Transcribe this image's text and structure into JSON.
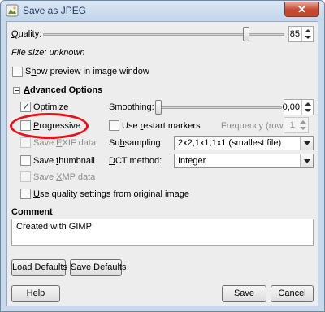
{
  "window": {
    "title": "Save as JPEG",
    "close_label": "✕"
  },
  "quality": {
    "label": "Quality:",
    "label_underline": "Q",
    "label_rest": "uality:",
    "value": "85",
    "level": 85,
    "max": 100
  },
  "file_size": "File size: unknown",
  "show_preview": {
    "label_underline": "h",
    "label_pre": "S",
    "label_rest": "ow preview in image window",
    "checked": false
  },
  "advanced": {
    "header": "Advanced Options",
    "header_underline": "A",
    "header_rest": "dvanced Options"
  },
  "optimize": {
    "label_underline": "O",
    "label_rest": "ptimize",
    "checked": true
  },
  "progressive": {
    "label_underline": "P",
    "label_rest": "rogressive",
    "checked": false
  },
  "save_exif": {
    "label_pre": "Save ",
    "label_underline": "E",
    "label_rest": "XIF data",
    "checked": false,
    "disabled": true
  },
  "save_thumbnail": {
    "label_pre": "Save ",
    "label_underline": "t",
    "label_rest": "humbnail",
    "checked": false
  },
  "save_xmp": {
    "label_pre": "Save ",
    "label_underline": "X",
    "label_rest": "MP data",
    "checked": false,
    "disabled": true
  },
  "use_quality": {
    "label_underline": "U",
    "label_rest": "se quality settings from original image",
    "checked": false
  },
  "smoothing": {
    "label_pre": "S",
    "label_underline": "m",
    "label_rest": "oothing:",
    "value": "0,00",
    "level": 0
  },
  "restart_markers": {
    "label_pre": "Use ",
    "label_underline": "r",
    "label_rest": "estart markers",
    "checked": false
  },
  "frequency": {
    "label": "Frequency (rows):",
    "value": "1"
  },
  "subsampling": {
    "label_pre": "Su",
    "label_underline": "b",
    "label_rest": "sampling:",
    "selected": "2x2,1x1,1x1 (smallest file)"
  },
  "dct": {
    "label_underline": "D",
    "label_rest": "CT method:",
    "selected": "Integer"
  },
  "comment": {
    "label": "Comment",
    "text": "Created with GIMP"
  },
  "buttons": {
    "load_defaults_underline": "L",
    "load_defaults_rest": "oad Defaults",
    "save_defaults_pre": "Sa",
    "save_defaults_underline": "v",
    "save_defaults_rest": "e Defaults",
    "help_underline": "H",
    "help_rest": "elp",
    "save_underline": "S",
    "save_rest": "ave",
    "cancel_underline": "C",
    "cancel_rest": "ancel"
  },
  "colors": {
    "highlight_ellipse": "#e4141b",
    "title_bar": "#c3d5ea",
    "dialog_bg": "#ededed"
  }
}
